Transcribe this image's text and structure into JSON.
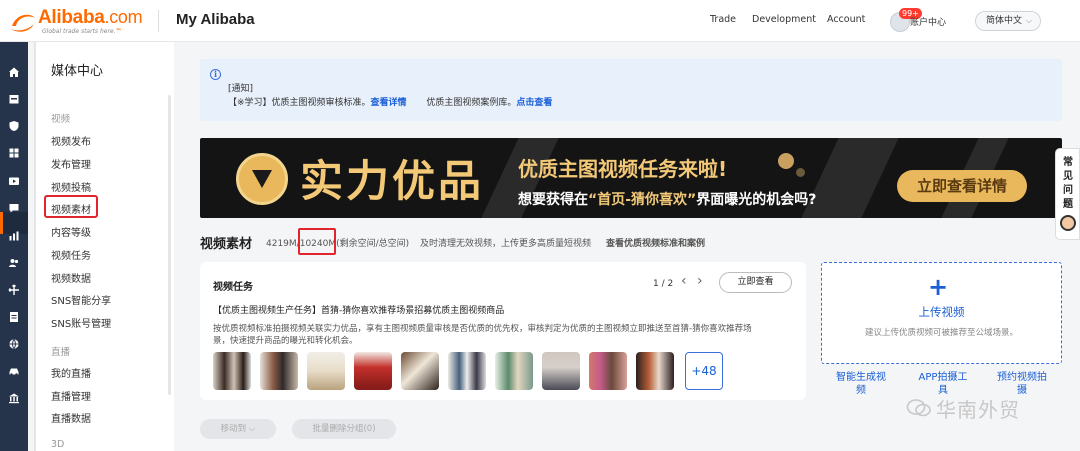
{
  "header": {
    "logo_text": "Alibaba",
    "logo_suffix": ".com",
    "logo_tagline_prefix": "Global trade starts here.",
    "logo_tagline_tm": "™",
    "brand": "My Alibaba",
    "nav": [
      "Trade",
      "Development",
      "Account"
    ],
    "account_badge": "99+",
    "account_label": "账户中心",
    "language": "简体中文",
    "accent": "#ff6a00"
  },
  "rail": {
    "icons": [
      "home-icon",
      "shop-icon",
      "shield-icon",
      "apps-icon",
      "video-icon",
      "chat-icon",
      "chart-icon",
      "users-icon",
      "logistics-icon",
      "document-icon",
      "globe-icon",
      "car-icon",
      "bank-icon"
    ]
  },
  "menu": {
    "title": "媒体中心",
    "group_video": "视频",
    "video_items": [
      "视频发布",
      "发布管理",
      "视频投稿",
      "视频素材",
      "内容等级",
      "视频任务",
      "视频数据",
      "SNS智能分享",
      "SNS账号管理"
    ],
    "group_live": "直播",
    "live_items": [
      "我的直播",
      "直播管理",
      "直播数据"
    ],
    "group_3d": "3D",
    "active_item": "视频素材"
  },
  "notice": {
    "heading": "[通知]",
    "text1": "【※学习】优质主图视频审核标准。",
    "link1": "查看详情",
    "text2": "优质主图视频案例库。",
    "link2": "点击查看"
  },
  "banner": {
    "big": "实力优品",
    "title": "优质主图视频任务来啦!",
    "sub_prefix": "想要获得在",
    "sub_highlight": "“首页-猜你喜欢”",
    "sub_suffix": "界面曝光的机会吗?",
    "button": "立即查看详情"
  },
  "materials": {
    "title": "视频素材",
    "used": "4219M",
    "sep": "/",
    "total": "10240M",
    "space_label": "(剩余空间/总空间)",
    "hint": "及时清理无效视频，上传更多高质量短视频",
    "link": "查看优质视频标准和案例"
  },
  "task": {
    "title": "视频任务",
    "pager": "1 / 2",
    "button": "立即查看",
    "task_title": "【优质主图视频生产任务】首猜-猜你喜欢推荐场景招募优质主图视频商品",
    "desc1": "按优质视频标准拍摄视频关联实力优品，享有主图视频质量审核是否优质的优先权，审核判定为优质的主图视频立即推送至首猜-猜你喜欢推荐场",
    "desc2": "景，快速提升商品的曝光和转化机会。",
    "more": "+48",
    "thumb_count": 11
  },
  "upload": {
    "title": "上传视频",
    "desc": "建议上传优质视频可被推荐至公域场景。",
    "tools": [
      {
        "l1": "智能生成视",
        "l2": "频"
      },
      {
        "l1": "APP拍摄工",
        "l2": "具"
      },
      {
        "l1": "预约视频拍",
        "l2": "摄"
      }
    ]
  },
  "actions": {
    "move": "移动到",
    "batch_delete": "批量删除分组(0)"
  },
  "float": {
    "help": "常见问题"
  },
  "watermark": {
    "text": "华南外贸"
  }
}
